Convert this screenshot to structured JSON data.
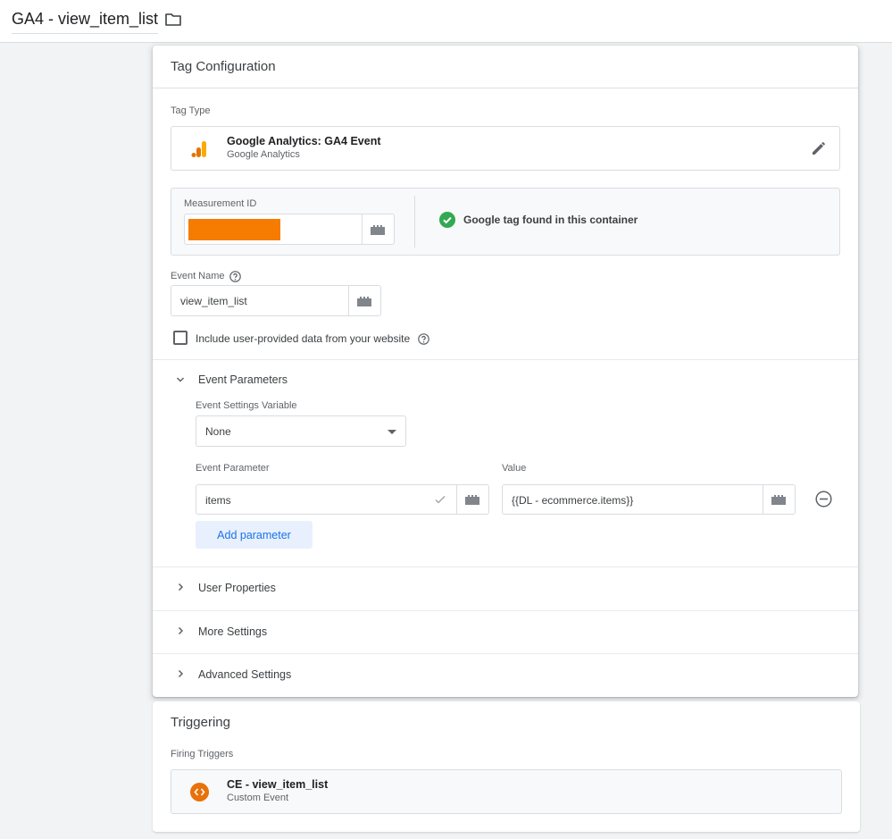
{
  "header": {
    "tag_name": "GA4 - view_item_list",
    "folder_icon": "folder-icon"
  },
  "config": {
    "title": "Tag Configuration",
    "tag_type_label": "Tag Type",
    "tag_type": {
      "name": "Google Analytics: GA4 Event",
      "vendor": "Google Analytics",
      "icon": "google-analytics-icon",
      "edit_icon": "pencil-icon"
    },
    "measurement": {
      "label": "Measurement ID",
      "value_redacted_color": "#f57c00",
      "status_text": "Google tag found in this container",
      "status_color": "#34a853"
    },
    "event_name": {
      "label": "Event Name",
      "value": "view_item_list"
    },
    "user_data": {
      "label": "Include user-provided data from your website",
      "checked": false
    },
    "event_parameters": {
      "label": "Event Parameters",
      "expanded": true,
      "settings_variable_label": "Event Settings Variable",
      "settings_variable_value": "None",
      "param_col_label": "Event Parameter",
      "value_col_label": "Value",
      "rows": [
        {
          "param": "items",
          "value": "{{DL - ecommerce.items}}"
        }
      ],
      "add_button": "Add parameter"
    },
    "sections": [
      {
        "label": "User Properties",
        "expanded": false
      },
      {
        "label": "More Settings",
        "expanded": false
      },
      {
        "label": "Advanced Settings",
        "expanded": false
      }
    ]
  },
  "triggering": {
    "title": "Triggering",
    "firing_label": "Firing Triggers",
    "trigger": {
      "name": "CE - view_item_list",
      "type": "Custom Event",
      "icon": "custom-event-icon",
      "icon_color": "#e8710a"
    }
  },
  "colors": {
    "accent": "#1a73e8",
    "ga_orange": "#f9ab00",
    "ga_dark_orange": "#e37400"
  }
}
